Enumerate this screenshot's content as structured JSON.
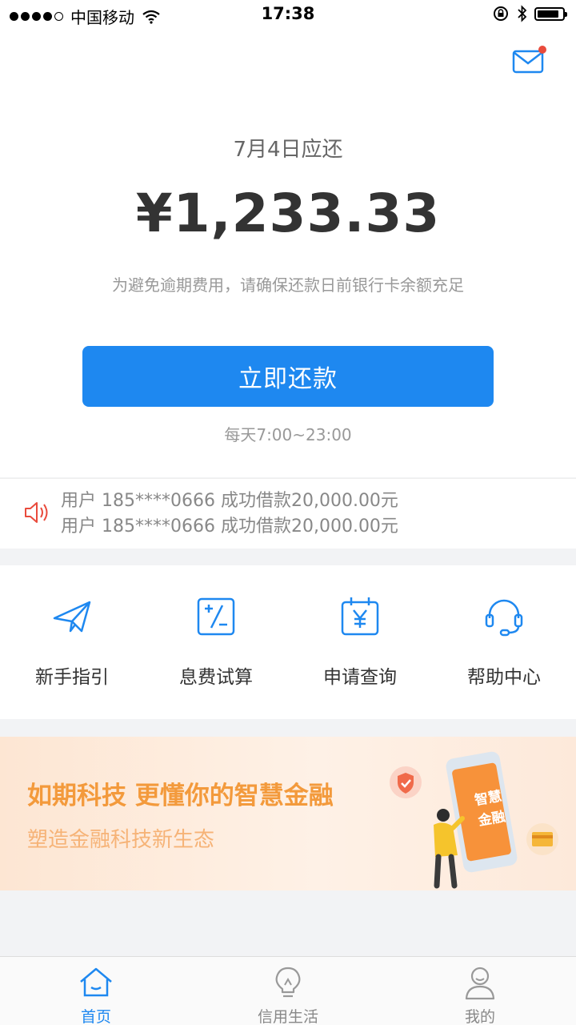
{
  "status_bar": {
    "carrier": "中国移动",
    "time": "17:38"
  },
  "repayment": {
    "due_label": "7月4日应还",
    "amount": "¥1,233.33",
    "tip": "为避免逾期费用，请确保还款日前银行卡余额充足",
    "pay_button": "立即还款",
    "service_hours": "每天7:00~23:00"
  },
  "notices": [
    "用户 185****0666 成功借款20,000.00元",
    "用户 185****0666 成功借款20,000.00元"
  ],
  "quick_menu": [
    {
      "label": "新手指引",
      "icon": "paper-plane-icon"
    },
    {
      "label": "息费试算",
      "icon": "calculator-icon"
    },
    {
      "label": "申请查询",
      "icon": "calendar-yen-icon"
    },
    {
      "label": "帮助中心",
      "icon": "headset-icon"
    }
  ],
  "banner": {
    "title": "如期科技 更懂你的智慧金融",
    "subtitle": "塑造金融科技新生态",
    "phone_text_line1": "智慧",
    "phone_text_line2": "金融"
  },
  "tabbar": [
    {
      "label": "首页",
      "icon": "home-icon",
      "active": true
    },
    {
      "label": "信用生活",
      "icon": "lightbulb-icon",
      "active": false
    },
    {
      "label": "我的",
      "icon": "user-icon",
      "active": false
    }
  ],
  "colors": {
    "primary": "#1e88f0",
    "banner_text": "#f39a3c",
    "notice_red": "#e94b3c"
  }
}
